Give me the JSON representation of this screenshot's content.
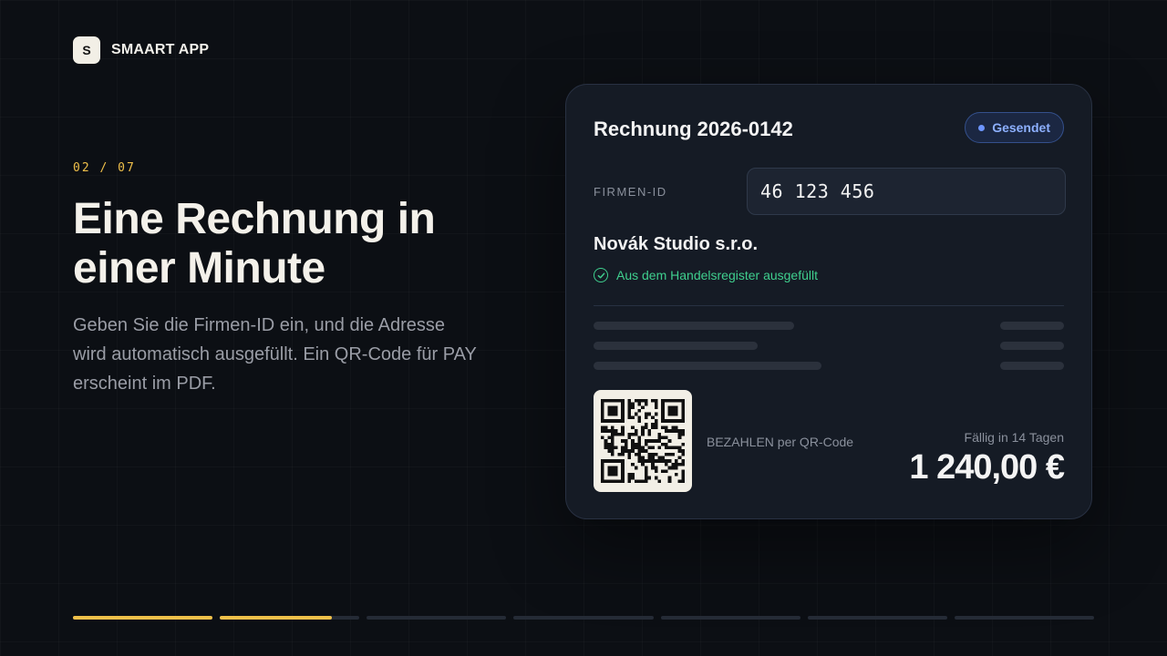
{
  "brand": {
    "logo_letter": "S",
    "name": "SMAART APP"
  },
  "slide": {
    "step": "02 / 07",
    "title": "Eine Rechnung in einer Minute",
    "subtitle": "Geben Sie die Firmen-ID ein, und die Adresse wird automatisch ausgefüllt. Ein QR-Code für PAY erscheint im PDF."
  },
  "invoice": {
    "title": "Rechnung 2026-0142",
    "status_badge": "Gesendet",
    "field_label": "FIRMEN-ID",
    "field_value": "46 123 456",
    "company_name": "Novák Studio s.r.o.",
    "autofill_note": "Aus dem Handelsregister ausgefüllt",
    "pay_label": "BEZAHLEN per QR-Code",
    "due_label": "Fällig in 14 Tagen",
    "amount": "1 240,00 €"
  },
  "progress": {
    "current_step": 2,
    "total_steps": 7,
    "current_step_fill": 0.8
  },
  "colors": {
    "background": "#0c0f14",
    "card": "#151b25",
    "accent_yellow": "#f0c04a",
    "status_blue": "#8db0ff",
    "success_green": "#3fcf8e"
  },
  "icons": {
    "verified": "check-circle-icon",
    "qr": "qr-code-icon"
  }
}
